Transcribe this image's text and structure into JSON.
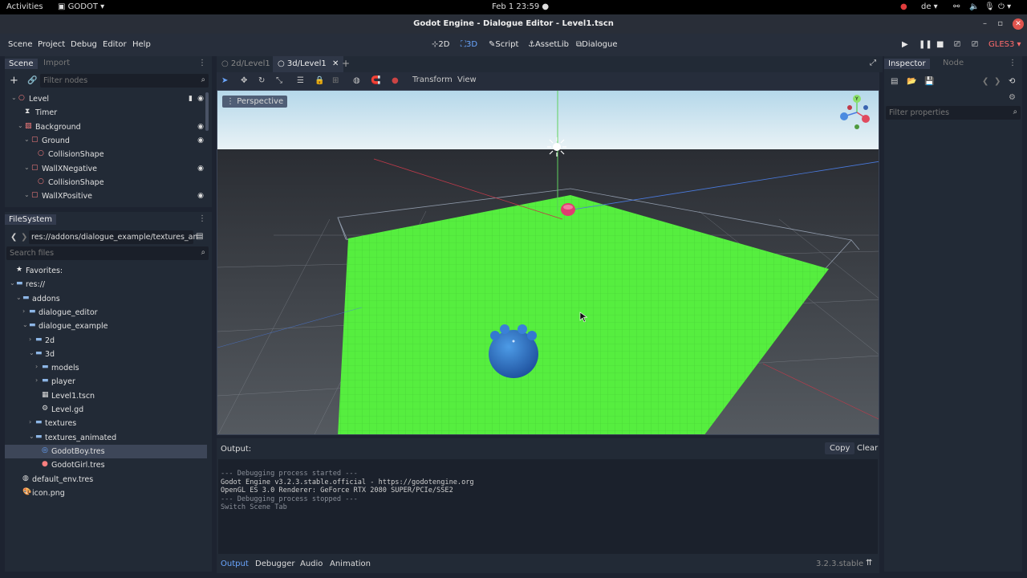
{
  "system_bar": {
    "activities": "Activities",
    "app": "GODOT",
    "clock": "Feb 1  23:59",
    "keyboard": "de"
  },
  "window": {
    "title": "Godot Engine - Dialogue Editor - Level1.tscn"
  },
  "menu": [
    "Scene",
    "Project",
    "Debug",
    "Editor",
    "Help"
  ],
  "workspaces": [
    "2D",
    "3D",
    "Script",
    "AssetLib",
    "Dialogue"
  ],
  "renderer": "GLES3",
  "scene_dock": {
    "tabs": [
      "Scene",
      "Import"
    ],
    "filter_placeholder": "Filter nodes",
    "nodes": [
      {
        "label": "Level",
        "depth": 0
      },
      {
        "label": "Timer",
        "depth": 1
      },
      {
        "label": "Background",
        "depth": 1
      },
      {
        "label": "Ground",
        "depth": 2
      },
      {
        "label": "CollisionShape",
        "depth": 3
      },
      {
        "label": "WallXNegative",
        "depth": 2
      },
      {
        "label": "CollisionShape",
        "depth": 3
      },
      {
        "label": "WallXPositive",
        "depth": 2
      }
    ]
  },
  "filesystem": {
    "title": "FileSystem",
    "path": "res://addons/dialogue_example/textures_an",
    "search_placeholder": "Search files",
    "items": [
      {
        "label": "Favorites:",
        "depth": 0
      },
      {
        "label": "res://",
        "depth": 0
      },
      {
        "label": "addons",
        "depth": 1
      },
      {
        "label": "dialogue_editor",
        "depth": 2
      },
      {
        "label": "dialogue_example",
        "depth": 2
      },
      {
        "label": "2d",
        "depth": 3
      },
      {
        "label": "3d",
        "depth": 3
      },
      {
        "label": "models",
        "depth": 4
      },
      {
        "label": "player",
        "depth": 4
      },
      {
        "label": "Level1.tscn",
        "depth": 4
      },
      {
        "label": "Level.gd",
        "depth": 4
      },
      {
        "label": "textures",
        "depth": 3
      },
      {
        "label": "textures_animated",
        "depth": 3
      },
      {
        "label": "GodotBoy.tres",
        "depth": 4
      },
      {
        "label": "GodotGirl.tres",
        "depth": 4
      },
      {
        "label": "default_env.tres",
        "depth": 1
      },
      {
        "label": "icon.png",
        "depth": 1
      }
    ]
  },
  "editor_tabs": [
    "2d/Level1",
    "3d/Level1"
  ],
  "viewport_toolbar": {
    "transform": "Transform",
    "view": "View"
  },
  "viewport": {
    "perspective_label": "Perspective"
  },
  "inspector": {
    "tabs": [
      "Inspector",
      "Node"
    ],
    "filter_placeholder": "Filter properties"
  },
  "output": {
    "title": "Output:",
    "copy": "Copy",
    "clear": "Clear",
    "lines": [
      "--- Debugging process started ---",
      "Godot Engine v3.2.3.stable.official - https://godotengine.org",
      "OpenGL ES 3.0 Renderer: GeForce RTX 2080 SUPER/PCIe/SSE2",
      "",
      "--- Debugging process stopped ---",
      "Switch Scene Tab"
    ],
    "bottom_tabs": [
      "Output",
      "Debugger",
      "Audio",
      "Animation"
    ],
    "version": "3.2.3.stable"
  },
  "colors": {
    "accent": "#6aa6ff",
    "ground": "#55ee44",
    "sky_top": "#b9dcec",
    "node_red": "#fc7f7f"
  }
}
